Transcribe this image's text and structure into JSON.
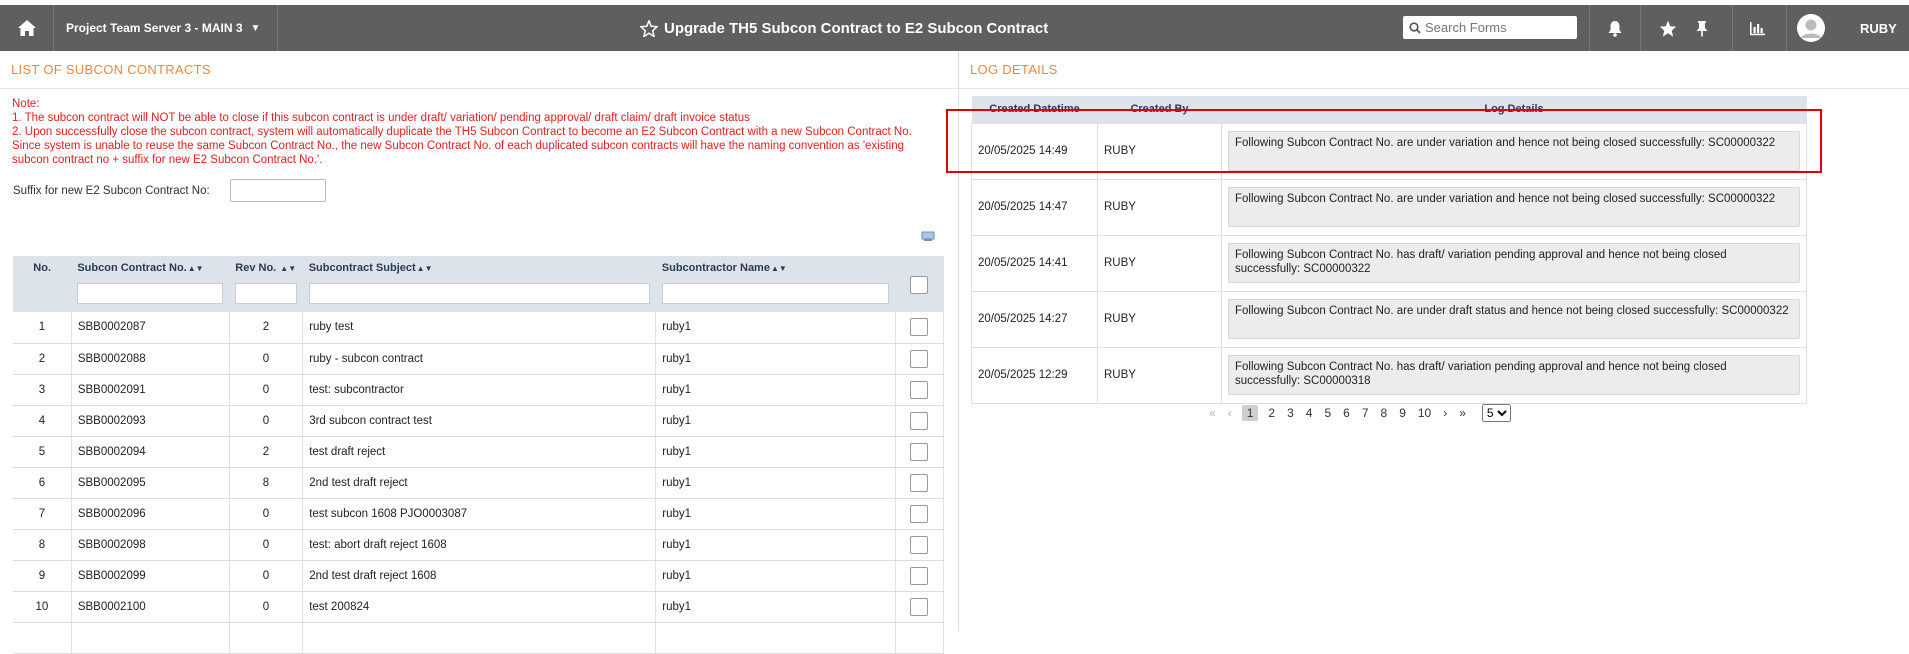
{
  "topbar": {
    "project": "Project Team Server 3 - MAIN 3",
    "title": "Upgrade TH5 Subcon Contract to E2 Subcon Contract",
    "search_placeholder": "Search Forms",
    "user": "RUBY"
  },
  "left": {
    "header": "LIST OF SUBCON CONTRACTS",
    "note_title": "Note:",
    "note_1": "1. The subcon contract will NOT be able to close if this subcon contract is under draft/ variation/ pending approval/ draft claim/ draft invoice status",
    "note_2": "2. Upon successfully close the subcon contract, system will automatically duplicate the TH5 Subcon Contract to become an E2 Subcon Contract with a new Subcon Contract No. Since system is unable to reuse the same Subcon Contract No., the new Subcon Contract No. of each duplicated subcon contracts will have the naming convention as 'existing subcon contract no + suffix for new E2 Subcon Contract No.'.",
    "suffix_label": "Suffix for new E2 Subcon Contract No:",
    "columns": [
      "No.",
      "Subcon Contract No.",
      "Rev No.",
      "Subcontract Subject",
      "Subcontractor Name"
    ],
    "rows": [
      {
        "no": "1",
        "contract": "SBB0002087",
        "rev": "2",
        "subject": "ruby test",
        "name": "ruby1"
      },
      {
        "no": "2",
        "contract": "SBB0002088",
        "rev": "0",
        "subject": "ruby - subcon contract",
        "name": "ruby1"
      },
      {
        "no": "3",
        "contract": "SBB0002091",
        "rev": "0",
        "subject": "test: subcontractor",
        "name": "ruby1"
      },
      {
        "no": "4",
        "contract": "SBB0002093",
        "rev": "0",
        "subject": "3rd subcon contract test",
        "name": "ruby1"
      },
      {
        "no": "5",
        "contract": "SBB0002094",
        "rev": "2",
        "subject": "test draft reject",
        "name": "ruby1"
      },
      {
        "no": "6",
        "contract": "SBB0002095",
        "rev": "8",
        "subject": "2nd test draft reject",
        "name": "ruby1"
      },
      {
        "no": "7",
        "contract": "SBB0002096",
        "rev": "0",
        "subject": "test subcon 1608 PJO0003087",
        "name": "ruby1"
      },
      {
        "no": "8",
        "contract": "SBB0002098",
        "rev": "0",
        "subject": "test: abort draft reject 1608",
        "name": "ruby1"
      },
      {
        "no": "9",
        "contract": "SBB0002099",
        "rev": "0",
        "subject": "2nd test draft reject 1608",
        "name": "ruby1"
      },
      {
        "no": "10",
        "contract": "SBB0002100",
        "rev": "0",
        "subject": "test 200824",
        "name": "ruby1"
      }
    ]
  },
  "right": {
    "header": "LOG DETAILS",
    "columns": [
      "Created Datetime",
      "Created By",
      "Log Details"
    ],
    "rows": [
      {
        "datetime": "20/05/2025 14:49",
        "by": "RUBY",
        "details": "Following Subcon Contract No. are under variation and hence not being closed successfully: SC00000322"
      },
      {
        "datetime": "20/05/2025 14:47",
        "by": "RUBY",
        "details": "Following Subcon Contract No. are under variation and hence not being closed successfully: SC00000322"
      },
      {
        "datetime": "20/05/2025 14:41",
        "by": "RUBY",
        "details": "Following Subcon Contract No. has draft/ variation pending approval and hence not being closed successfully: SC00000322"
      },
      {
        "datetime": "20/05/2025 14:27",
        "by": "RUBY",
        "details": "Following Subcon Contract No. are under draft status and hence not being closed successfully: SC00000322"
      },
      {
        "datetime": "20/05/2025 12:29",
        "by": "RUBY",
        "details": "Following Subcon Contract No. has draft/ variation pending approval and hence not being closed successfully: SC00000318"
      }
    ],
    "pager": {
      "pages": [
        "1",
        "2",
        "3",
        "4",
        "5",
        "6",
        "7",
        "8",
        "9",
        "10"
      ],
      "page_size": "5"
    }
  }
}
